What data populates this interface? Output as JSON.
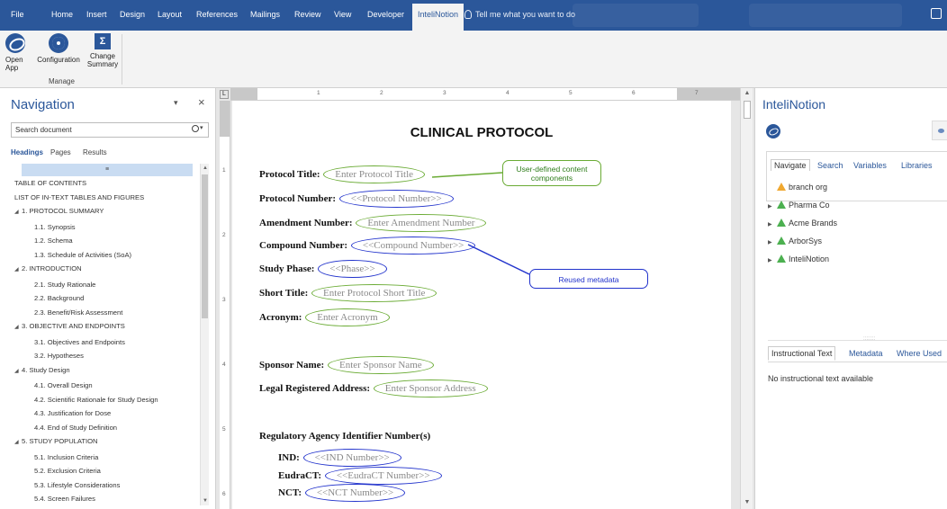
{
  "menu": {
    "tabs": [
      "File",
      "Home",
      "Insert",
      "Design",
      "Layout",
      "References",
      "Mailings",
      "Review",
      "View",
      "Developer",
      "InteliNotion"
    ],
    "active_tab": "InteliNotion",
    "tell_me": "Tell me what you want to do"
  },
  "ribbon": {
    "open_app": "Open App",
    "configuration": "Configuration",
    "change_summary": "Change Summary",
    "group_label": "Manage"
  },
  "navigation": {
    "title": "Navigation",
    "search_placeholder": "Search document",
    "tabs": [
      "Headings",
      "Pages",
      "Results"
    ],
    "selected_marker": "≡",
    "items": [
      {
        "label": "TABLE OF CONTENTS",
        "level": 0,
        "toggle": false
      },
      {
        "label": "LIST OF IN-TEXT TABLES AND FIGURES",
        "level": 0,
        "toggle": false
      },
      {
        "label": "1. PROTOCOL SUMMARY",
        "level": 0,
        "toggle": true
      },
      {
        "label": "1.1. Synopsis",
        "level": 1,
        "toggle": false
      },
      {
        "label": "1.2. Schema",
        "level": 1,
        "toggle": false
      },
      {
        "label": "1.3. Schedule of Activities (SoA)",
        "level": 1,
        "toggle": false
      },
      {
        "label": "2. INTRODUCTION",
        "level": 0,
        "toggle": true
      },
      {
        "label": "2.1. Study Rationale",
        "level": 1,
        "toggle": false
      },
      {
        "label": "2.2. Background",
        "level": 1,
        "toggle": false
      },
      {
        "label": "2.3. Benefit/Risk Assessment",
        "level": 1,
        "toggle": false
      },
      {
        "label": "3. OBJECTIVE AND ENDPOINTS",
        "level": 0,
        "toggle": true
      },
      {
        "label": "3.1. Objectives and Endpoints",
        "level": 1,
        "toggle": false
      },
      {
        "label": "3.2. Hypotheses",
        "level": 1,
        "toggle": false
      },
      {
        "label": "4. Study Design",
        "level": 0,
        "toggle": true
      },
      {
        "label": "4.1. Overall Design",
        "level": 1,
        "toggle": false
      },
      {
        "label": "4.2. Scientific Rationale for Study Design",
        "level": 1,
        "toggle": false
      },
      {
        "label": "4.3. Justification for Dose",
        "level": 1,
        "toggle": false
      },
      {
        "label": "4.4. End of Study Definition",
        "level": 1,
        "toggle": false
      },
      {
        "label": "5. STUDY POPULATION",
        "level": 0,
        "toggle": true
      },
      {
        "label": "5.1. Inclusion Criteria",
        "level": 1,
        "toggle": false
      },
      {
        "label": "5.2. Exclusion Criteria",
        "level": 1,
        "toggle": false
      },
      {
        "label": "5.3. Lifestyle Considerations",
        "level": 1,
        "toggle": false
      },
      {
        "label": "5.4. Screen Failures",
        "level": 1,
        "toggle": false
      }
    ]
  },
  "ruler": {
    "h_numbers": [
      "1",
      "2",
      "3",
      "4",
      "5",
      "6",
      "7"
    ],
    "v_numbers": [
      "1",
      "2",
      "3",
      "4",
      "5",
      "6"
    ]
  },
  "document": {
    "title": "CLINICAL PROTOCOL",
    "protocol_title_label": "Protocol Title:",
    "protocol_title_value": "Enter Protocol Title",
    "protocol_number_label": "Protocol Number:",
    "protocol_number_value": "<<Protocol Number>>",
    "amendment_label": "Amendment Number:",
    "amendment_value": "Enter Amendment Number",
    "compound_label": "Compound Number:",
    "compound_value": "<<Compound Number>>",
    "phase_label": "Study Phase:",
    "phase_value": "<<Phase>>",
    "short_title_label": "Short Title:",
    "short_title_value": "Enter Protocol Short Title",
    "acronym_label": "Acronym:",
    "acronym_value": "Enter Acronym",
    "sponsor_label": "Sponsor Name:",
    "sponsor_value": "Enter Sponsor Name",
    "address_label": "Legal Registered Address:",
    "address_value": "Enter Sponsor Address",
    "regulatory_heading": "Regulatory Agency Identifier Number(s)",
    "ind_label": "IND:",
    "ind_value": "<<IND Number>>",
    "eudract_label": "EudraCT:",
    "eudract_value": "<<EudraCT Number>>",
    "nct_label": "NCT:",
    "nct_value": "<<NCT Number>>",
    "callout_user_defined": "User-defined content components",
    "callout_reused": "Reused metadata"
  },
  "pane": {
    "title": "InteliNotion",
    "tabs": [
      "Navigate",
      "Search",
      "Variables",
      "Libraries"
    ],
    "orgs": [
      {
        "label": "branch org",
        "color": "orange",
        "toggle": false
      },
      {
        "label": "Pharma Co",
        "color": "green",
        "toggle": true
      },
      {
        "label": "Acme Brands",
        "color": "green",
        "toggle": true
      },
      {
        "label": "ArborSys",
        "color": "green",
        "toggle": true
      },
      {
        "label": "InteliNotion",
        "color": "green",
        "toggle": true
      }
    ],
    "lower_tabs": [
      "Instructional Text",
      "Metadata",
      "Where Used"
    ],
    "no_text": "No instructional text available"
  },
  "colors": {
    "accent": "#2b579a",
    "user_defined_outline": "#6aab34",
    "metadata_outline": "#2233cc"
  }
}
